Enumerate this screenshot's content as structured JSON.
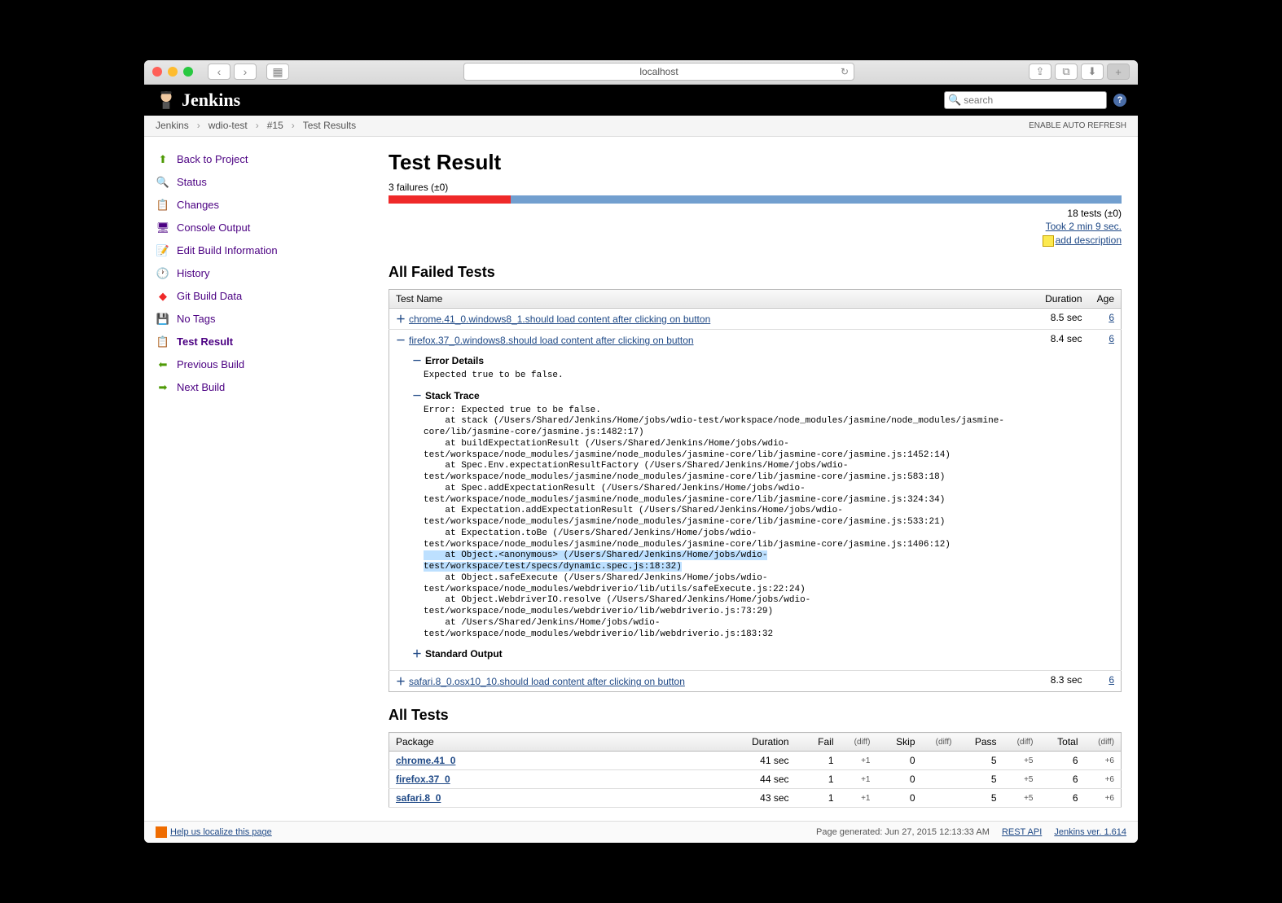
{
  "browser": {
    "url": "localhost"
  },
  "header": {
    "brand": "Jenkins",
    "search_placeholder": "search"
  },
  "breadcrumbs": [
    "Jenkins",
    "wdio-test",
    "#15",
    "Test Results"
  ],
  "auto_refresh": "ENABLE AUTO REFRESH",
  "sidebar": {
    "back": "Back to Project",
    "status": "Status",
    "changes": "Changes",
    "console": "Console Output",
    "edit": "Edit Build Information",
    "history": "History",
    "git": "Git Build Data",
    "tags": "No Tags",
    "result": "Test Result",
    "prev": "Previous Build",
    "next": "Next Build"
  },
  "main": {
    "title": "Test Result",
    "failures": "3 failures (±0)",
    "progress": {
      "red_pct": 16.7,
      "blue_pct": 83.3
    },
    "tests_summary": "18 tests (±0)",
    "took": "Took 2 min 9 sec.",
    "add_desc": "add description"
  },
  "failed": {
    "heading": "All Failed Tests",
    "cols": {
      "name": "Test Name",
      "duration": "Duration",
      "age": "Age"
    },
    "rows": [
      {
        "name": "chrome.41_0.windows8_1.should load content after clicking on button",
        "duration": "8.5 sec",
        "age": "6"
      },
      {
        "name": "firefox.37_0.windows8.should load content after clicking on button",
        "duration": "8.4 sec",
        "age": "6"
      },
      {
        "name": "safari.8_0.osx10_10.should load content after clicking on button",
        "duration": "8.3 sec",
        "age": "6"
      }
    ],
    "expanded": {
      "error_heading": "Error Details",
      "error_msg": "Expected true to be false.",
      "stack_heading": "Stack Trace",
      "stack": "Error: Expected true to be false.\n    at stack (/Users/Shared/Jenkins/Home/jobs/wdio-test/workspace/node_modules/jasmine/node_modules/jasmine-core/lib/jasmine-core/jasmine.js:1482:17)\n    at buildExpectationResult (/Users/Shared/Jenkins/Home/jobs/wdio-test/workspace/node_modules/jasmine/node_modules/jasmine-core/lib/jasmine-core/jasmine.js:1452:14)\n    at Spec.Env.expectationResultFactory (/Users/Shared/Jenkins/Home/jobs/wdio-test/workspace/node_modules/jasmine/node_modules/jasmine-core/lib/jasmine-core/jasmine.js:583:18)\n    at Spec.addExpectationResult (/Users/Shared/Jenkins/Home/jobs/wdio-test/workspace/node_modules/jasmine/node_modules/jasmine-core/lib/jasmine-core/jasmine.js:324:34)\n    at Expectation.addExpectationResult (/Users/Shared/Jenkins/Home/jobs/wdio-test/workspace/node_modules/jasmine/node_modules/jasmine-core/lib/jasmine-core/jasmine.js:533:21)\n    at Expectation.toBe (/Users/Shared/Jenkins/Home/jobs/wdio-test/workspace/node_modules/jasmine/node_modules/jasmine-core/lib/jasmine-core/jasmine.js:1406:12)",
      "stack_hl": "    at Object.<anonymous> (/Users/Shared/Jenkins/Home/jobs/wdio-test/workspace/test/specs/dynamic.spec.js:18:32)",
      "stack2": "    at Object.safeExecute (/Users/Shared/Jenkins/Home/jobs/wdio-test/workspace/node_modules/webdriverio/lib/utils/safeExecute.js:22:24)\n    at Object.WebdriverIO.resolve (/Users/Shared/Jenkins/Home/jobs/wdio-test/workspace/node_modules/webdriverio/lib/webdriverio.js:73:29)\n    at /Users/Shared/Jenkins/Home/jobs/wdio-test/workspace/node_modules/webdriverio/lib/webdriverio.js:183:32",
      "stdout_heading": "Standard Output"
    }
  },
  "all_tests": {
    "heading": "All Tests",
    "cols": {
      "pkg": "Package",
      "duration": "Duration",
      "fail": "Fail",
      "skip": "Skip",
      "pass": "Pass",
      "total": "Total",
      "diff": "(diff)"
    },
    "rows": [
      {
        "pkg": "chrome.41_0",
        "duration": "41 sec",
        "fail": "1",
        "fail_diff": "+1",
        "skip": "0",
        "skip_diff": "",
        "pass": "5",
        "pass_diff": "+5",
        "total": "6",
        "total_diff": "+6"
      },
      {
        "pkg": "firefox.37_0",
        "duration": "44 sec",
        "fail": "1",
        "fail_diff": "+1",
        "skip": "0",
        "skip_diff": "",
        "pass": "5",
        "pass_diff": "+5",
        "total": "6",
        "total_diff": "+6"
      },
      {
        "pkg": "safari.8_0",
        "duration": "43 sec",
        "fail": "1",
        "fail_diff": "+1",
        "skip": "0",
        "skip_diff": "",
        "pass": "5",
        "pass_diff": "+5",
        "total": "6",
        "total_diff": "+6"
      }
    ]
  },
  "footer": {
    "localize": "Help us localize this page",
    "generated": "Page generated: Jun 27, 2015 12:13:33 AM",
    "rest": "REST API",
    "ver": "Jenkins ver. 1.614"
  }
}
